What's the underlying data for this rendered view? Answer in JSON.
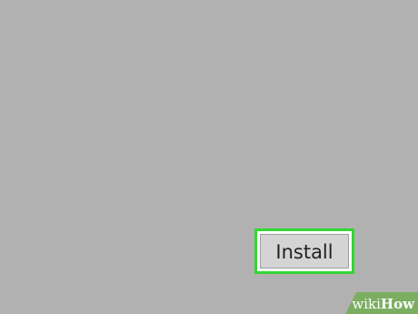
{
  "screen": {
    "background_color": "#b1b1b1"
  },
  "install_button": {
    "label": "Install",
    "highlight_color": "#33d633"
  },
  "watermark": {
    "prefix": "wiki",
    "suffix": "How",
    "icon": "wikihow-watermark"
  }
}
